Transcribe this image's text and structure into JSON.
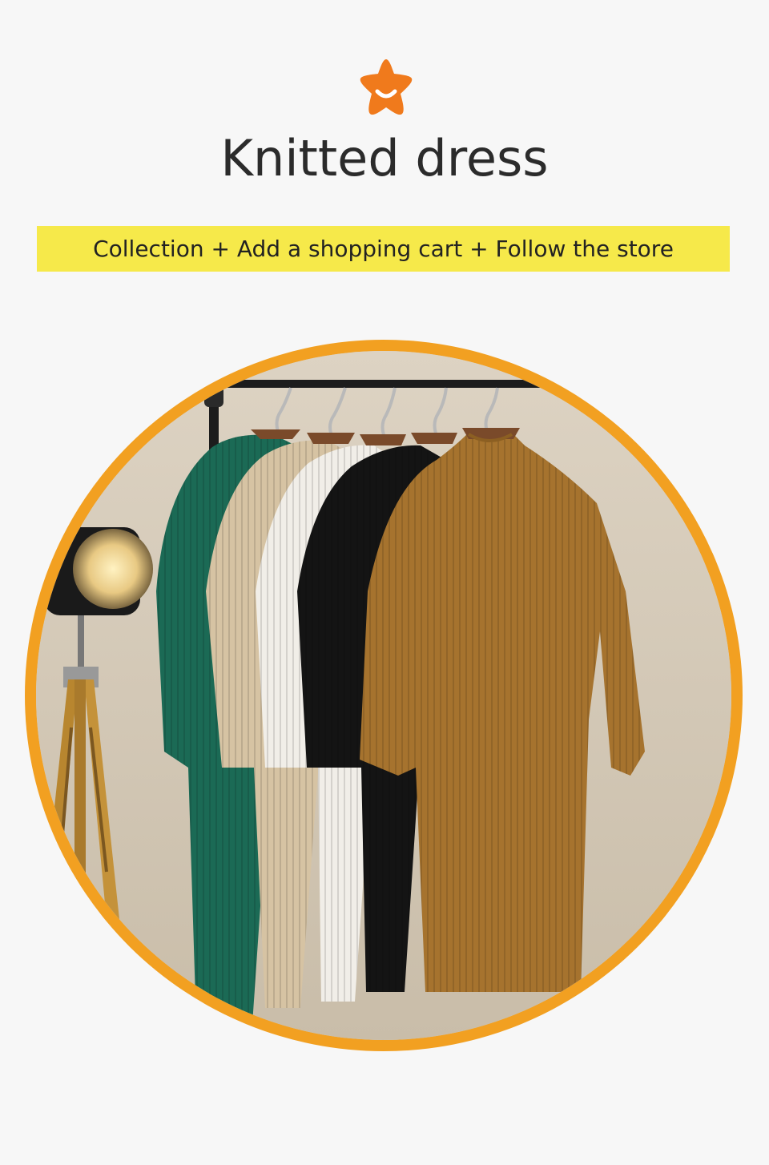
{
  "page": {
    "title": "Knitted dress",
    "banner_text": "Collection + Add a shopping cart + Follow the store"
  },
  "icons": {
    "top": "star-smile-icon"
  },
  "colors": {
    "background": "#f7f7f7",
    "star": "#f07a1c",
    "banner": "#f6e94a",
    "frame": "#f2a021",
    "title_text": "#2b2b2b",
    "dress_green": "#1b6a55",
    "dress_beige": "#d6c3a3",
    "dress_white": "#f1eee8",
    "dress_black": "#141414",
    "dress_brown": "#a6732e"
  },
  "photo": {
    "subject": "five knitted dresses on hangers",
    "dresses": [
      "green",
      "beige",
      "white",
      "black",
      "brown"
    ]
  }
}
